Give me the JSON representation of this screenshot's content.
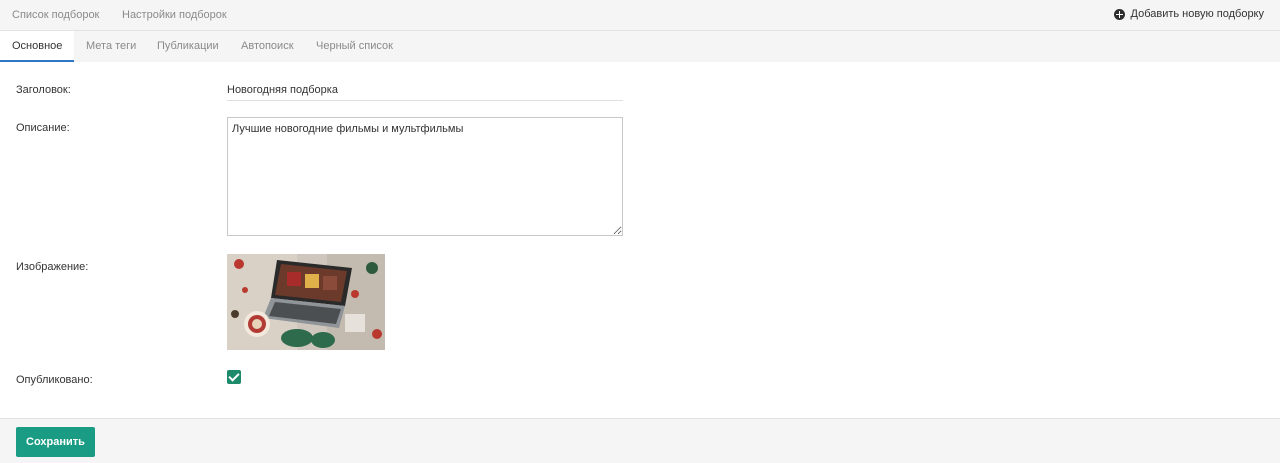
{
  "topnav": {
    "items": [
      "Список подборок",
      "Настройки подборок"
    ],
    "add_label": "Добавить новую подборку",
    "add_icon": "plus-circle-icon"
  },
  "tabs": [
    "Основное",
    "Мета теги",
    "Публикации",
    "Автопоиск",
    "Черный список"
  ],
  "active_tab": 0,
  "form": {
    "title_label": "Заголовок:",
    "title_value": "Новогодняя подборка",
    "description_label": "Описание:",
    "description_value": "Лучшие новогодние фильмы и мультфильмы",
    "image_label": "Изображение:",
    "published_label": "Опубликовано:",
    "published": true
  },
  "footer": {
    "save_label": "Сохранить"
  },
  "colors": {
    "accent": "#1a9c84",
    "checkbox": "#1c8a6b",
    "tab_underline": "#2f77c6"
  }
}
